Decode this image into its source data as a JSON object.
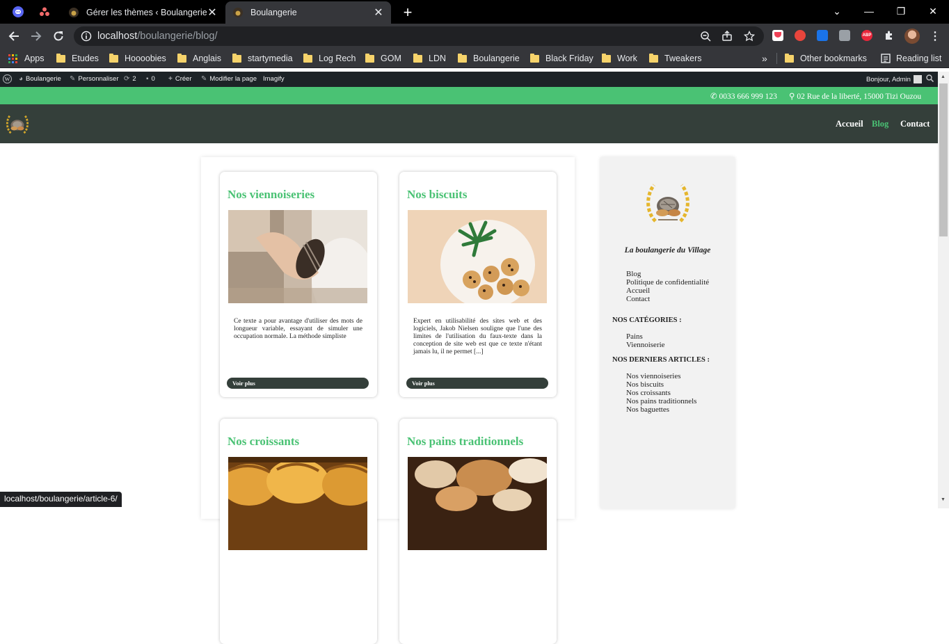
{
  "browser": {
    "tabs": [
      {
        "title": "Gérer les thèmes ‹ Boulangerie —",
        "active": false
      },
      {
        "title": "Boulangerie",
        "active": true
      }
    ],
    "url_host": "localhost",
    "url_path": "/boulangerie/blog/",
    "bookmarks": [
      "Etudes",
      "Hoooobies",
      "Anglais",
      "startymedia",
      "Log Rech",
      "GOM",
      "LDN",
      "Boulangerie",
      "Black Friday",
      "Work",
      "Tweakers"
    ],
    "apps_label": "Apps",
    "overflow": "»",
    "other_bookmarks": "Other bookmarks",
    "reading_list": "Reading list",
    "status_url": "localhost/boulangerie/article-6/"
  },
  "admin_bar": {
    "site": "Boulangerie",
    "customize": "Personnaliser",
    "updates": "2",
    "comments": "0",
    "create": "Créer",
    "edit": "Modifier la page",
    "imagify": "Imagify",
    "greeting": "Bonjour, Admin"
  },
  "site": {
    "phone": "0033 666 999 123",
    "address": "02 Rue de la liberté, 15000 Tizi Ouzou",
    "nav": [
      "Accueil",
      "Blog",
      "Contact"
    ],
    "active_nav": "Blog",
    "posts": [
      {
        "title": "Nos viennoiseries",
        "excerpt": "Ce texte a pour avantage d'utiliser des mots de longueur variable, essayant de simuler une occupation normale. La méthode simpliste",
        "more": "Voir plus"
      },
      {
        "title": "Nos biscuits",
        "excerpt": "Expert en utilisabilité des sites web et des logiciels, Jakob Nielsen souligne que l'une des limites de l'utilisation du faux-texte dans la conception de site web est que ce texte n'étant jamais lu, il ne permet [...]",
        "more": "Voir plus"
      },
      {
        "title": "Nos croissants"
      },
      {
        "title": "Nos pains traditionnels"
      }
    ],
    "sidebar": {
      "tagline": "La boulangerie du Village",
      "pages": [
        "Blog",
        "Politique de confidentialité",
        "Accueil",
        "Contact"
      ],
      "categories_title": "NOS CATÉGORIES :",
      "categories": [
        "Pains",
        "Viennoiserie"
      ],
      "recent_title": "NOS DERNIERS ARTICLES :",
      "recent": [
        "Nos viennoiseries",
        "Nos biscuits",
        "Nos croissants",
        "Nos pains traditionnels",
        "Nos baguettes"
      ]
    },
    "colors": {
      "accent": "#4ac274",
      "dark": "#343f3a"
    }
  }
}
